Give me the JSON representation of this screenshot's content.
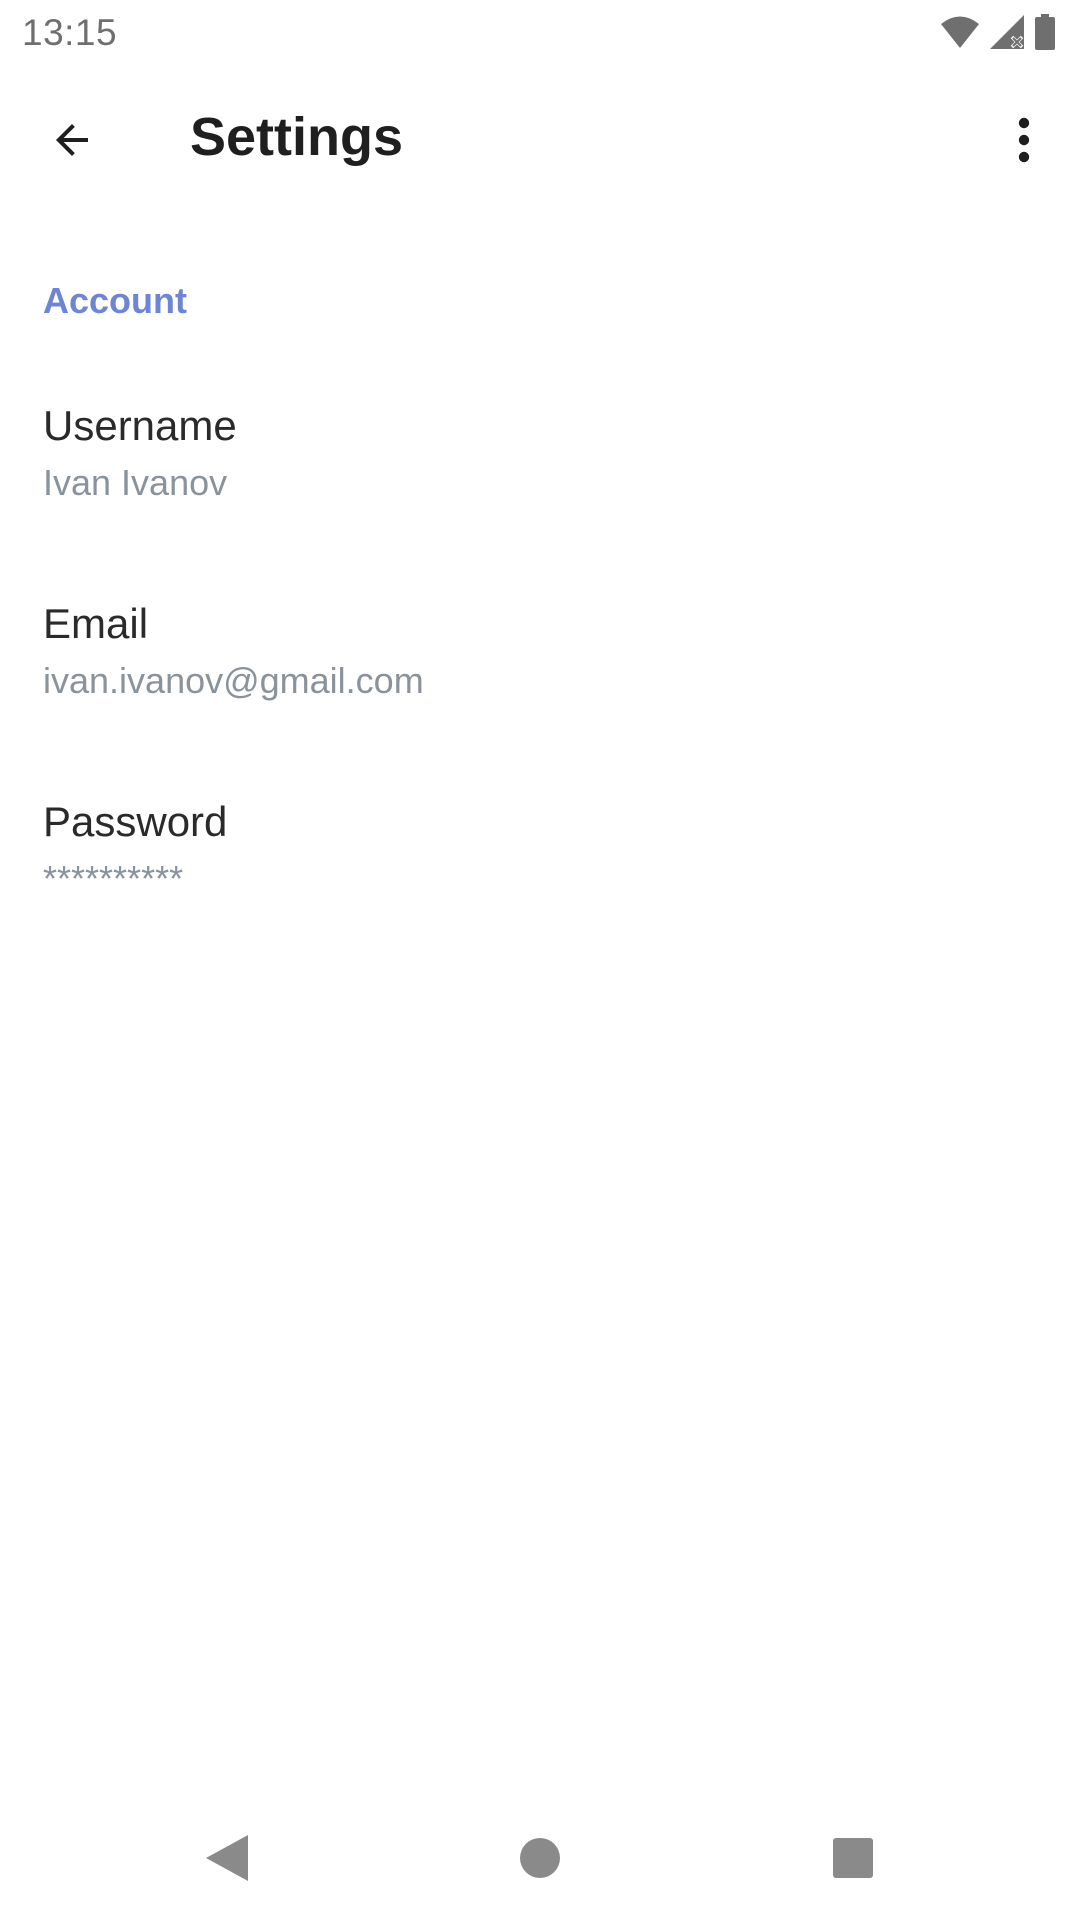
{
  "status_bar": {
    "time": "13:15",
    "icons": [
      "wifi-icon",
      "cellular-signal-icon",
      "battery-icon"
    ]
  },
  "app_bar": {
    "title": "Settings",
    "back_icon": "arrow-back-icon",
    "overflow_icon": "more-vert-icon"
  },
  "section": {
    "header": "Account"
  },
  "items": [
    {
      "title": "Username",
      "summary": "Ivan Ivanov"
    },
    {
      "title": "Email",
      "summary": "ivan.ivanov@gmail.com"
    },
    {
      "title": "Password",
      "summary": "**********"
    }
  ],
  "nav_bar": {
    "icons": [
      "nav-back-icon",
      "nav-home-icon",
      "nav-recents-icon"
    ]
  },
  "colors": {
    "accent": "#6d85d4",
    "title_text": "#1f1f1f",
    "item_title": "#2a2a2a",
    "item_summary": "#8a939c",
    "status_icons": "#6f6f6f",
    "nav_icons": "#8a8a8a"
  }
}
